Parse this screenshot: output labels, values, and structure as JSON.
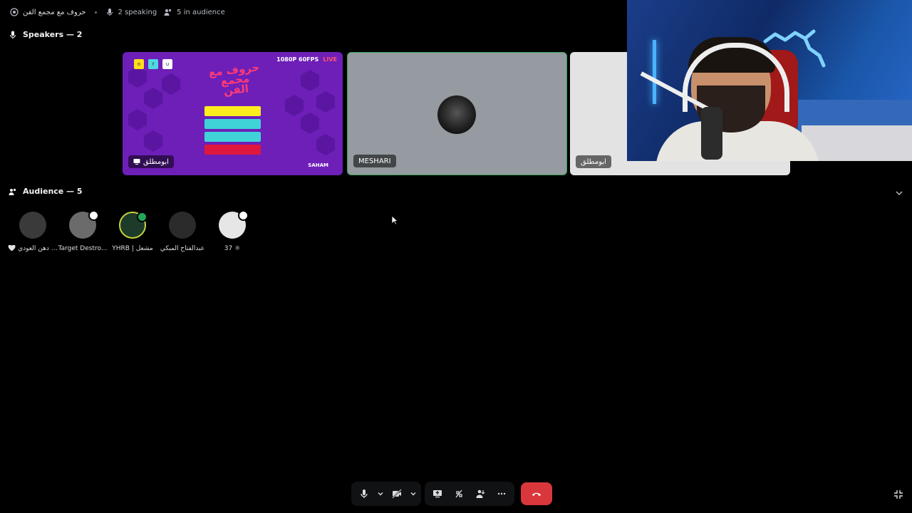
{
  "topbar": {
    "channel_name": "حروف مع مجمع الفن",
    "speaking": "2 speaking",
    "audience": "5 in audience"
  },
  "speakers": {
    "header": "Speakers — 2",
    "tiles": [
      {
        "name": "ابومطلق",
        "live_badge": "LIVE",
        "quality": "1080P 60FPS",
        "game_title": "حروف مع مجمع الفن",
        "logo": "SAHAM"
      },
      {
        "name": "MESHARI"
      },
      {
        "name": "ابومطلق"
      }
    ]
  },
  "audience": {
    "header": "Audience — 5",
    "members": [
      {
        "name": "🤍 سعدي دهن العودي",
        "avatar_color": "#3a3a3a",
        "status": ""
      },
      {
        "name": "Target Destro...",
        "avatar_color": "#6b6b6b",
        "status": "#ffffff"
      },
      {
        "name": "YHRB | مشعل",
        "avatar_color": "#1d3b2a",
        "status": "#23a55a"
      },
      {
        "name": "عبدالفتاح المبكي",
        "avatar_color": "#2b2b2b",
        "status": ""
      },
      {
        "name": "37 ⚛",
        "avatar_color": "#e6e6e6",
        "status": "#ffffff"
      }
    ]
  },
  "colors": {
    "speaking_border": "#3ba55d",
    "hangup": "#da373c",
    "game_bg": "#6d1fb8"
  },
  "icons": [
    "radio-icon",
    "mic-icon",
    "audience-icon",
    "chevron-down-icon",
    "video-off-icon",
    "screen-share-icon",
    "activity-icon",
    "more-icon",
    "phone-hangup-icon",
    "minimize-icon"
  ]
}
